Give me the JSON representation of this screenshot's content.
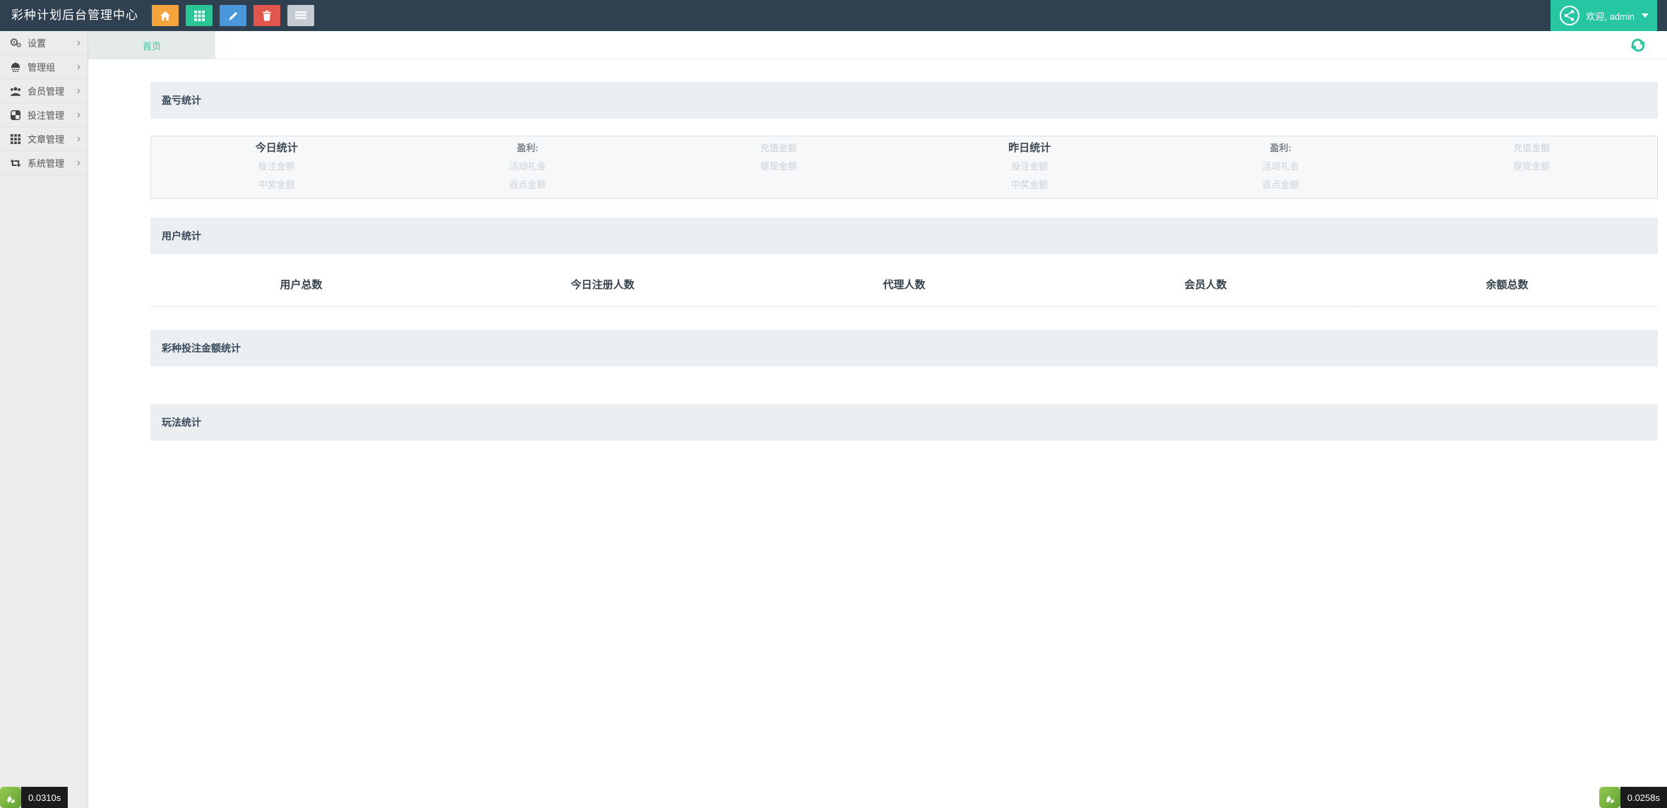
{
  "header": {
    "title": "彩种计划后台管理中心",
    "toolbar_buttons": [
      {
        "icon": "home-icon",
        "color": "#f5a43c"
      },
      {
        "icon": "grid-icon",
        "color": "#2bc495"
      },
      {
        "icon": "pencil-icon",
        "color": "#4a97dc"
      },
      {
        "icon": "trash-icon",
        "color": "#e2574c"
      },
      {
        "icon": "list-icon",
        "color": "#c5cbd2"
      }
    ],
    "welcome": "欢迎, admin"
  },
  "glyphs": {
    "chevron_right": "›",
    "gear": "⚙"
  },
  "sidebar": {
    "items": [
      {
        "icon": "cogs-icon",
        "label": "设置"
      },
      {
        "icon": "group-dome-icon",
        "label": "管理组"
      },
      {
        "icon": "users-icon",
        "label": "会员管理"
      },
      {
        "icon": "checkerboard-icon",
        "label": "投注管理"
      },
      {
        "icon": "grid-th-icon",
        "label": "文章管理"
      },
      {
        "icon": "sync-arrows-icon",
        "label": "系统管理"
      }
    ]
  },
  "tabs": {
    "items": [
      {
        "label": "首页",
        "active": true
      }
    ]
  },
  "sections": {
    "profit": {
      "title": "盈亏统计",
      "groups": [
        {
          "period": "今日统计",
          "period_rows": [
            "投注金额",
            "中奖金额"
          ],
          "profit_label": "盈利:",
          "profit_rows": [
            "活动礼金",
            "返点金额"
          ],
          "amount_rows": [
            "充值金额",
            "提现金额"
          ]
        },
        {
          "period": "昨日统计",
          "period_rows": [
            "投注金额",
            "中奖金额"
          ],
          "profit_label": "盈利:",
          "profit_rows": [
            "活动礼金",
            "返点金额"
          ],
          "amount_rows": [
            "充值金额",
            "提现金额"
          ]
        }
      ]
    },
    "users": {
      "title": "用户统计",
      "stats": [
        "用户总数",
        "今日注册人数",
        "代理人数",
        "会员人数",
        "余额总数"
      ]
    },
    "lottery_amount": {
      "title": "彩种投注金额统计"
    },
    "play": {
      "title": "玩法统计"
    }
  },
  "footer": {
    "left_time": "0.0310s",
    "right_time": "0.0258s"
  },
  "colors": {
    "header_bg": "#2f4050",
    "accent_teal": "#26c6a2",
    "sidebar_bg": "#ececec",
    "panel_header_bg": "#eceff1",
    "trace_green": "#7eb94c",
    "trace_dark": "#1b1b1b"
  }
}
